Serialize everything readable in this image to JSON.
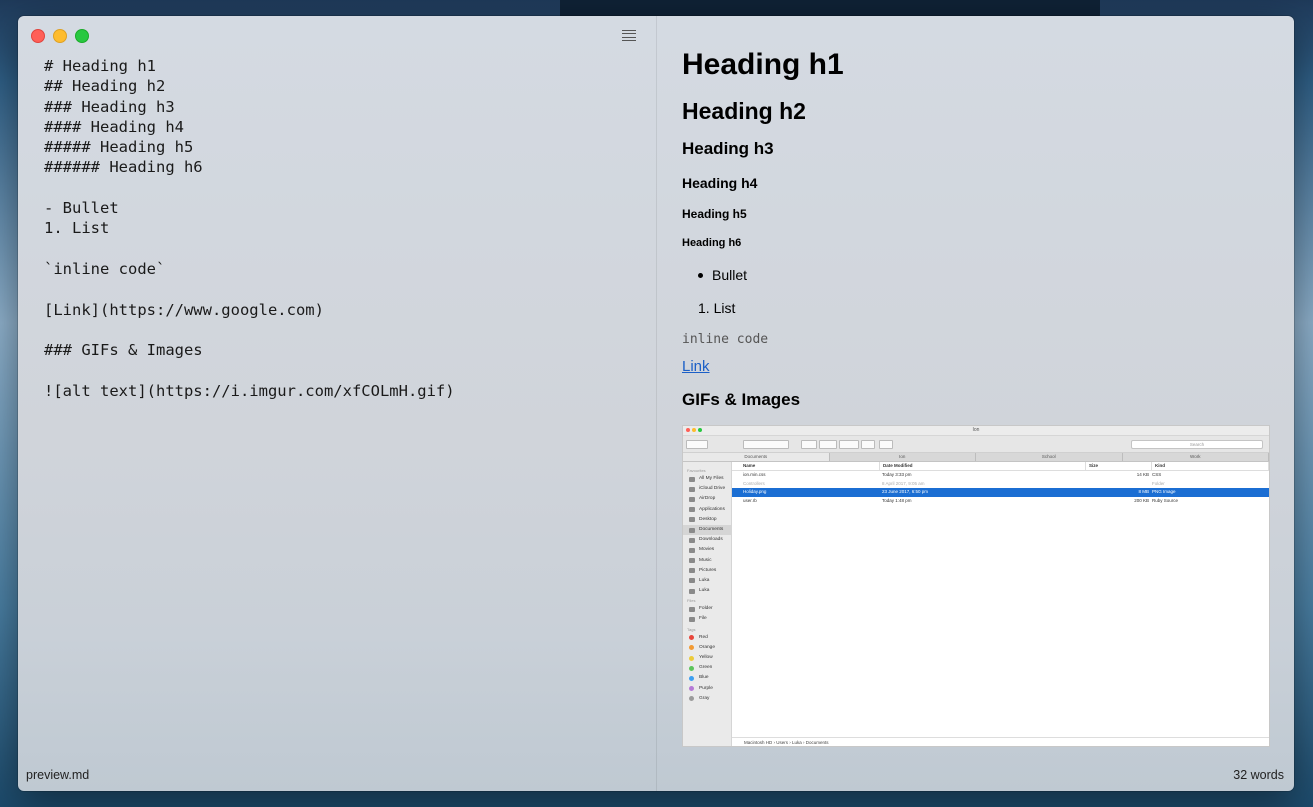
{
  "editor": {
    "lines": [
      "# Heading h1",
      "## Heading h2",
      "### Heading h3",
      "#### Heading h4",
      "##### Heading h5",
      "###### Heading h6",
      "",
      "- Bullet",
      "1. List",
      "",
      "`inline code`",
      "",
      "[Link](https://www.google.com)",
      "",
      "### GIFs & Images",
      "",
      "![alt text](https://i.imgur.com/xfCOLmH.gif)"
    ]
  },
  "preview": {
    "h1": "Heading h1",
    "h2": "Heading h2",
    "h3": "Heading h3",
    "h4": "Heading h4",
    "h5": "Heading h5",
    "h6": "Heading h6",
    "bullet": "Bullet",
    "list_item": "1. List",
    "inline_code": "inline code",
    "link": "Link",
    "gifs_heading": "GIFs & Images"
  },
  "finder": {
    "title": "Ion",
    "search_placeholder": "Search",
    "tabs": [
      "Documents",
      "Ion",
      "School",
      "Work"
    ],
    "sidebar": [
      {
        "label": "Favourites",
        "type": "section"
      },
      {
        "label": "All My Files",
        "type": "item"
      },
      {
        "label": "iCloud Drive",
        "type": "item"
      },
      {
        "label": "AirDrop",
        "type": "item"
      },
      {
        "label": "Applications",
        "type": "item"
      },
      {
        "label": "Desktop",
        "type": "item"
      },
      {
        "label": "Documents",
        "type": "item",
        "selected": true
      },
      {
        "label": "Downloads",
        "type": "item"
      },
      {
        "label": "Movies",
        "type": "item"
      },
      {
        "label": "Music",
        "type": "item"
      },
      {
        "label": "Pictures",
        "type": "item"
      },
      {
        "label": "Luka",
        "type": "item"
      },
      {
        "label": "Luka",
        "type": "item"
      },
      {
        "label": "Files",
        "type": "section"
      },
      {
        "label": "Folder",
        "type": "item"
      },
      {
        "label": "File",
        "type": "item"
      },
      {
        "label": "Tags",
        "type": "section"
      },
      {
        "label": "Red",
        "type": "tag",
        "color": "#e8463b"
      },
      {
        "label": "Orange",
        "type": "tag",
        "color": "#f29a33"
      },
      {
        "label": "Yellow",
        "type": "tag",
        "color": "#eccb3a"
      },
      {
        "label": "Green",
        "type": "tag",
        "color": "#5cc45a"
      },
      {
        "label": "Blue",
        "type": "tag",
        "color": "#3d9ff0"
      },
      {
        "label": "Purple",
        "type": "tag",
        "color": "#b57ad6"
      },
      {
        "label": "Gray",
        "type": "tag",
        "color": "#9b9b9b"
      }
    ],
    "columns": [
      "Name",
      "Date Modified",
      "Size",
      "Kind"
    ],
    "rows": [
      {
        "name": "ion.min.css",
        "date": "Today 3:33 pm",
        "size": "14 KB",
        "kind": "CSS",
        "state": ""
      },
      {
        "name": "Controllers",
        "date": "8 April 2017, 9:05 am",
        "size": "",
        "kind": "Folder",
        "state": "dim"
      },
      {
        "name": "Holiday.png",
        "date": "23 June 2017, 6:50 pm",
        "size": "8 MB",
        "kind": "PNG Image",
        "state": "sel"
      },
      {
        "name": "user.rb",
        "date": "Today 1:48 pm",
        "size": "200 KB",
        "kind": "Ruby Source",
        "state": ""
      }
    ],
    "path": "Macintosh HD  ›  Users  ›  Luka  ›  Documents"
  },
  "status": {
    "filename": "preview.md",
    "word_count": "32 words"
  }
}
